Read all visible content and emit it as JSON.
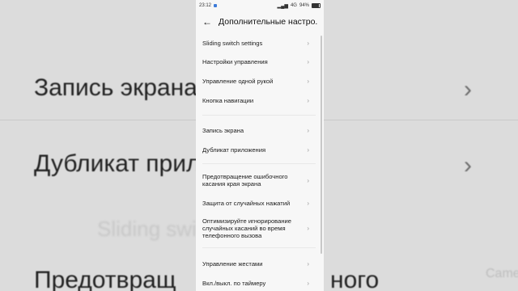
{
  "background": {
    "rows": [
      {
        "label": "Запись экрана"
      },
      {
        "label": "Дубликат прил"
      },
      {
        "label": "Предотвращ"
      }
    ],
    "tail_text": "ного",
    "faint_text": "Sliding switch",
    "right_faint": "Camera"
  },
  "status_bar": {
    "time": "23:12",
    "battery": "94%",
    "net": "4G"
  },
  "header": {
    "back_icon": "←",
    "title": "Дополнительные настро..."
  },
  "items": [
    {
      "label": "Sliding switch settings"
    },
    {
      "label": "Настройки управления"
    },
    {
      "label": "Управление одной рукой"
    },
    {
      "label": "Кнопка навигации"
    },
    {
      "label": "Запись экрана"
    },
    {
      "label": "Дубликат приложения"
    },
    {
      "label": "Предотвращение ошибочного касания края экрана"
    },
    {
      "label": "Защита от случайных нажатий"
    },
    {
      "label": "Оптимизируйте игнорирование случайных касаний во время телефонного вызова"
    },
    {
      "label": "Управление жестами"
    },
    {
      "label": "Вкл./выкл. по таймеру"
    }
  ],
  "colors": {
    "accent": "#3d7bd9",
    "screen_bg": "#f7f7f7"
  }
}
